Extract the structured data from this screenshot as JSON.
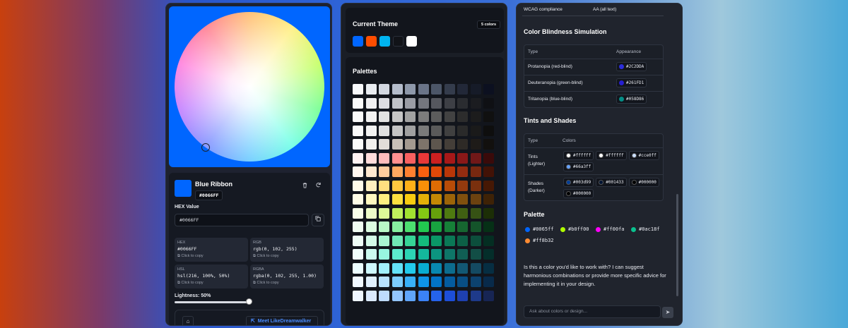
{
  "picker": {
    "name": "Blue Ribbon",
    "hex": "#0066FF",
    "hex_label": "HEX Value",
    "hex_input": "#0066FF",
    "formats": [
      {
        "key": "HEX",
        "value": "#0066FF",
        "copy": "Click to copy"
      },
      {
        "key": "RGB",
        "value": "rgb(0, 102, 255)",
        "copy": "Click to copy"
      },
      {
        "key": "HSL",
        "value": "hsl(216, 100%, 50%)",
        "copy": "Click to copy"
      },
      {
        "key": "RGBA",
        "value": "rgba(0, 102, 255, 1.00)",
        "copy": "Click to copy"
      }
    ],
    "lightness_label": "Lightness: 50%",
    "lightness": 0.5,
    "meet_label": "Meet LikeDreamwalker"
  },
  "theme": {
    "title": "Current Theme",
    "count": "5 colors",
    "colors": [
      "#0066ff",
      "#ff4d00",
      "#00b4f0",
      "#111318",
      "#ffffff"
    ]
  },
  "palettes": {
    "title": "Palettes",
    "rows": [
      [
        "#f8f9fb",
        "#e9ecf1",
        "#d3d8e1",
        "#b4bccb",
        "#8e98aa",
        "#6a7488",
        "#4c5668",
        "#343c4c",
        "#222838",
        "#161b28",
        "#0c1020"
      ],
      [
        "#fafafa",
        "#f0f0f2",
        "#dcdde2",
        "#c0c2c8",
        "#9a9ca4",
        "#74767e",
        "#55575e",
        "#3d3f45",
        "#2a2c30",
        "#1b1c20",
        "#0f1014"
      ],
      [
        "#fafafa",
        "#f2f2f2",
        "#e2e2e2",
        "#c6c6c6",
        "#a2a2a2",
        "#7c7c7c",
        "#5c5c5c",
        "#424242",
        "#2c2c2c",
        "#1c1c1c",
        "#101010"
      ],
      [
        "#fafafa",
        "#f2f2f2",
        "#e0e0e0",
        "#c4c4c4",
        "#a0a0a0",
        "#7a7a7a",
        "#5a5a5a",
        "#404040",
        "#2a2a2a",
        "#1a1a1a",
        "#0e0e0e"
      ],
      [
        "#fafaf9",
        "#f2f0ee",
        "#e2ddd8",
        "#c8c0b8",
        "#a49a90",
        "#7e746a",
        "#5e564e",
        "#443e38",
        "#2e2a26",
        "#1e1b18",
        "#12100e"
      ],
      [
        "#fff2f2",
        "#ffdcdc",
        "#ffbcbc",
        "#ff9090",
        "#f86060",
        "#e83838",
        "#cc2020",
        "#a81818",
        "#8a1818",
        "#701818",
        "#3a0a0a"
      ],
      [
        "#fff6ee",
        "#ffe8d0",
        "#ffcc9e",
        "#ffa860",
        "#ff8030",
        "#f86010",
        "#e04808",
        "#ba3608",
        "#942c10",
        "#782810",
        "#421206"
      ],
      [
        "#fffbea",
        "#fff0c0",
        "#ffe080",
        "#ffc840",
        "#ffb018",
        "#f89008",
        "#de6c04",
        "#b84c08",
        "#943a0e",
        "#7a300e",
        "#461804"
      ],
      [
        "#fefce6",
        "#fef8c0",
        "#fef080",
        "#fce040",
        "#f8cc10",
        "#e4b008",
        "#c48804",
        "#9c6408",
        "#80500e",
        "#6c4210",
        "#3e2206"
      ],
      [
        "#f8fee8",
        "#eefcc8",
        "#dcf898",
        "#c0f05c",
        "#a2e230",
        "#84c814",
        "#66a00c",
        "#4e7a10",
        "#406012",
        "#365214",
        "#1c2e06"
      ],
      [
        "#f0fdf2",
        "#dcfce2",
        "#baf8c8",
        "#86f0a0",
        "#4ce070",
        "#22c850",
        "#18a440",
        "#168038",
        "#166630",
        "#14542a",
        "#063016"
      ],
      [
        "#eefdf6",
        "#d4fae8",
        "#aaf4d2",
        "#70e8b6",
        "#36d496",
        "#14ba7c",
        "#0a9666",
        "#0a7856",
        "#0c6046",
        "#0c4e3c",
        "#042e22"
      ],
      [
        "#f0fdfa",
        "#ccfbf0",
        "#98f6e0",
        "#5ceacc",
        "#2cd4b4",
        "#14b89c",
        "#0c9480",
        "#0e7668",
        "#105e54",
        "#124e46",
        "#042e2a"
      ],
      [
        "#ecfdff",
        "#cef8fe",
        "#a2f0fc",
        "#64e2f8",
        "#22caec",
        "#08acd2",
        "#0888b0",
        "#0c6c8e",
        "#125874",
        "#144a62",
        "#062e42"
      ],
      [
        "#f0f8ff",
        "#e0f0fe",
        "#b8e2fe",
        "#7cccfc",
        "#38b0f8",
        "#0e94e8",
        "#0274c6",
        "#045ca0",
        "#084e84",
        "#0c426e",
        "#082a4a"
      ],
      [
        "#eff6ff",
        "#dbeafe",
        "#bfdbfe",
        "#93c5fd",
        "#60a5fa",
        "#3b82f6",
        "#2563eb",
        "#1d4ed8",
        "#1e40af",
        "#1e3a8a",
        "#172554"
      ]
    ]
  },
  "analysis": {
    "wcag_label": "WCAG compliance",
    "wcag_value": "AA (all text)",
    "blind_title": "Color Blindness Simulation",
    "blind_headers": [
      "Type",
      "Appearance"
    ],
    "blind_rows": [
      {
        "type": "Protanopia (red-blind)",
        "hex": "#2C2DDA",
        "color": "#2c2dda"
      },
      {
        "type": "Deuteranopia (green-blind)",
        "hex": "#261FD1",
        "color": "#261fd1"
      },
      {
        "type": "Tritanopia (blue-blind)",
        "hex": "#058D86",
        "color": "#058d86"
      }
    ],
    "tints_title": "Tints and Shades",
    "tints_headers": [
      "Type",
      "Colors"
    ],
    "tints": {
      "label1": "Tints",
      "label2": "(Lighter)",
      "chips": [
        {
          "hex": "#ffffff",
          "color": "#ffffff"
        },
        {
          "hex": "#ffffff",
          "color": "#ffffff"
        },
        {
          "hex": "#cce0ff",
          "color": "#cce0ff"
        },
        {
          "hex": "#66a3ff",
          "color": "#66a3ff"
        }
      ]
    },
    "shades": {
      "label1": "Shades",
      "label2": "(Darker)",
      "chips": [
        {
          "hex": "#003d99",
          "color": "#003d99"
        },
        {
          "hex": "#001433",
          "color": "#001433"
        },
        {
          "hex": "#000000",
          "color": "#000000"
        },
        {
          "hex": "#000000",
          "color": "#000000"
        }
      ]
    },
    "palette_title": "Palette",
    "palette": [
      {
        "hex": "#0065ff",
        "color": "#0065ff"
      },
      {
        "hex": "#b0ff00",
        "color": "#b0ff00"
      },
      {
        "hex": "#ff00fa",
        "color": "#ff00fa"
      },
      {
        "hex": "#0ac18f",
        "color": "#0ac18f"
      },
      {
        "hex": "#ff8b32",
        "color": "#ff8b32"
      }
    ],
    "message": "Is this a color you'd like to work with? I can suggest harmonious combinations or provide more specific advice for implementing it in your design.",
    "ask_placeholder": "Ask about colors or design..."
  }
}
